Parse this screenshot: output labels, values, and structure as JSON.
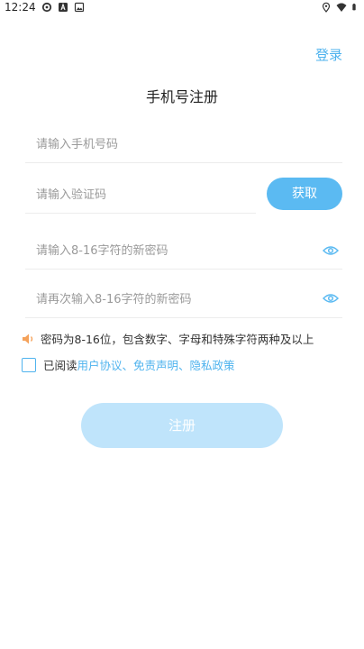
{
  "status_bar": {
    "time": "12:24",
    "left_icons": [
      "sync-icon",
      "a-box-icon",
      "image-box-icon"
    ],
    "right_icons": [
      "location-icon",
      "wifi-icon",
      "battery-icon"
    ]
  },
  "header": {
    "login_label": "登录",
    "title": "手机号注册"
  },
  "form": {
    "phone_placeholder": "请输入手机号码",
    "code_placeholder": "请输入验证码",
    "get_code_label": "获取",
    "password_placeholder": "请输入8-16字符的新密码",
    "confirm_password_placeholder": "请再次输入8-16字符的新密码",
    "password_hint": "密码为8-16位，包含数字、字母和特殊字符两种及以上",
    "agree_prefix": "已阅读",
    "agree_links": "用户协议、免责声明、隐私政策",
    "register_label": "注册"
  },
  "colors": {
    "accent": "#5bbaf2",
    "accent_light": "#bfe4fb",
    "hint_icon": "#f5a25a"
  }
}
